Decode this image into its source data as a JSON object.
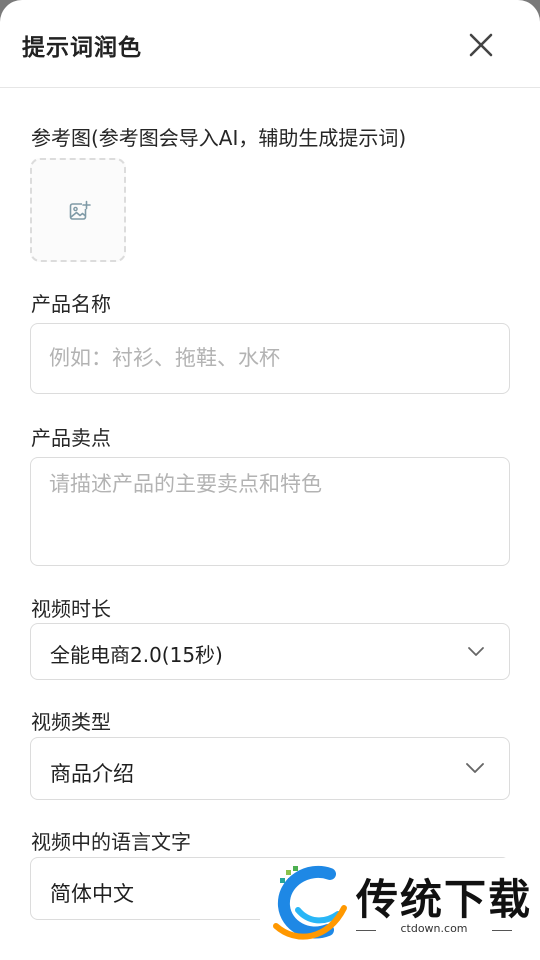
{
  "dialog": {
    "title": "提示词润色",
    "close_icon": "close-icon"
  },
  "reference_image": {
    "label": "参考图(参考图会导入AI，辅助生成提示词)",
    "icon": "add-image-icon"
  },
  "product_name": {
    "label": "产品名称",
    "value": "",
    "placeholder": "例如：衬衫、拖鞋、水杯"
  },
  "selling_points": {
    "label": "产品卖点",
    "value": "",
    "placeholder": "请描述产品的主要卖点和特色"
  },
  "video_duration": {
    "label": "视频时长",
    "selected": "全能电商2.0(15秒)"
  },
  "video_type": {
    "label": "视频类型",
    "selected": "商品介绍"
  },
  "video_language": {
    "label": "视频中的语言文字",
    "selected": "简体中文"
  },
  "watermark": {
    "brand": "传统下载",
    "domain": "ctdown.com"
  },
  "colors": {
    "border": "#dcdcdc",
    "placeholder": "#b3b3b3",
    "text": "#1f1f1f",
    "icon": "#7f9aa6"
  }
}
